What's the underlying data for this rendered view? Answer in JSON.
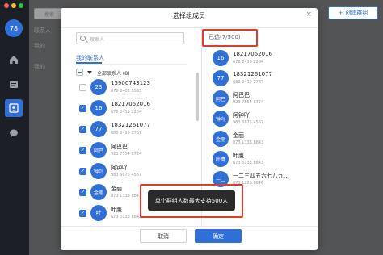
{
  "rail": {
    "avatar_text": "78",
    "nav_icons": [
      "home-icon",
      "calendar-icon",
      "contacts-icon",
      "chat-icon"
    ]
  },
  "background": {
    "search_placeholder": "搜索",
    "items": [
      "联系人",
      "我的",
      "我的"
    ],
    "create_group_label": "创建群组"
  },
  "modal": {
    "title": "选择组成员",
    "close_symbol": "×",
    "search_placeholder": "搜索人",
    "tab_label": "我的联系人",
    "group_label": "全部联系人 (8)",
    "contacts": [
      {
        "avatar": "23",
        "name": "15900743123",
        "number": "876 2402 5533",
        "checked": false
      },
      {
        "avatar": "16",
        "name": "18217052016",
        "number": "676 2419 2284",
        "checked": true
      },
      {
        "avatar": "77",
        "name": "18321261077",
        "number": "680 2419 2787",
        "checked": true
      },
      {
        "avatar": "阿巴",
        "name": "阿巴巴",
        "number": "923 7554 8724",
        "checked": true
      },
      {
        "avatar": "钟吖",
        "name": "阿钟吖",
        "number": "983 6675 4567",
        "checked": true
      },
      {
        "avatar": "金丽",
        "name": "金丽",
        "number": "873 1333 8843",
        "checked": true
      },
      {
        "avatar": "叶",
        "name": "叶鹰",
        "number": "673 5133 8843",
        "checked": true
      }
    ],
    "selected_label": "已选(7/500)",
    "selected": [
      {
        "avatar": "16",
        "name": "18217052016",
        "number": "676 2419 2284"
      },
      {
        "avatar": "77",
        "name": "18321261077",
        "number": "680 2419 2787"
      },
      {
        "avatar": "阿巴",
        "name": "阿巴巴",
        "number": "923 7554 8724"
      },
      {
        "avatar": "钟吖",
        "name": "阿钟吖",
        "number": "983 6675 4567"
      },
      {
        "avatar": "金丽",
        "name": "金丽",
        "number": "873 1333 8843"
      },
      {
        "avatar": "叶鹰",
        "name": "叶鹰",
        "number": "673 5133 8843"
      },
      {
        "avatar": "一二",
        "name": "一二三四五六七八九...",
        "number": "673 1225 8846"
      }
    ],
    "cancel_label": "取消",
    "ok_label": "确定",
    "toast": "单个群组人数最大支持500人"
  },
  "colors": {
    "accent": "#2f6fd6",
    "highlight_red": "#e23a2e",
    "rail_bg": "#1c1f26"
  }
}
